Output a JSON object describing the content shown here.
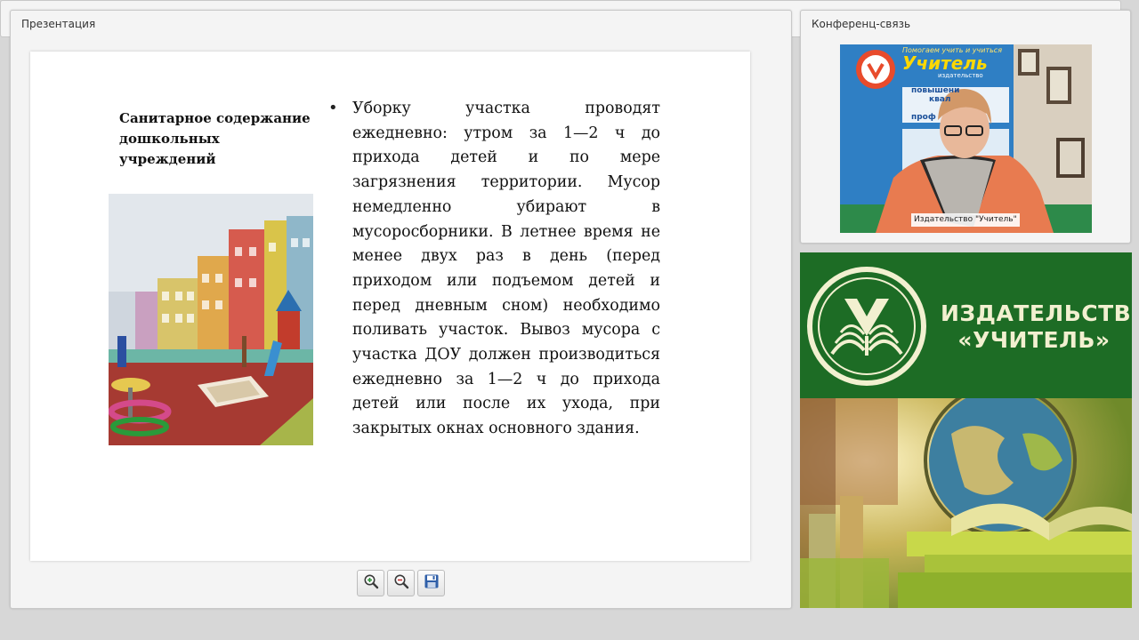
{
  "presentation": {
    "title": "Презентация",
    "slide": {
      "heading": "Санитарное содержание дошкольных учреждений",
      "bullet_glyph": "•",
      "body": "Уборку участка проводят ежедневно: утром за 1—2 ч до прихода детей и по мере загрязнения территории. Мусор немедленно убирают в мусоросборники. В летнее время не менее двух раз в день (перед приходом или подъемом детей и перед дневным сном) необходимо поливать участок. Вывоз мусора с участка ДОУ должен производиться ежедневно за 1—2 ч до прихода детей или после их ухода, при закрытых окнах основного здания.",
      "photo": "kindergarten-playground-photo"
    },
    "toolbar": {
      "buttons": [
        {
          "icon": "zoom-in-icon"
        },
        {
          "icon": "zoom-out-icon"
        },
        {
          "icon": "save-icon"
        }
      ]
    }
  },
  "conference": {
    "title": "Конференц-связь",
    "speaker_caption": "Издательство \"Учитель\"",
    "backdrop_sign": {
      "line1": "Помогаем учить и учиться",
      "brand": "Учитель",
      "sub": "издательство",
      "items": [
        "повышени",
        "квал",
        "проф"
      ]
    }
  },
  "banner": {
    "name_line1": "ИЗДАТЕЛЬСТВО",
    "name_line2": "«УЧИТЕЛЬ»",
    "colors": {
      "green": "#1d6c25",
      "emblem": "#f2f0d0"
    }
  }
}
